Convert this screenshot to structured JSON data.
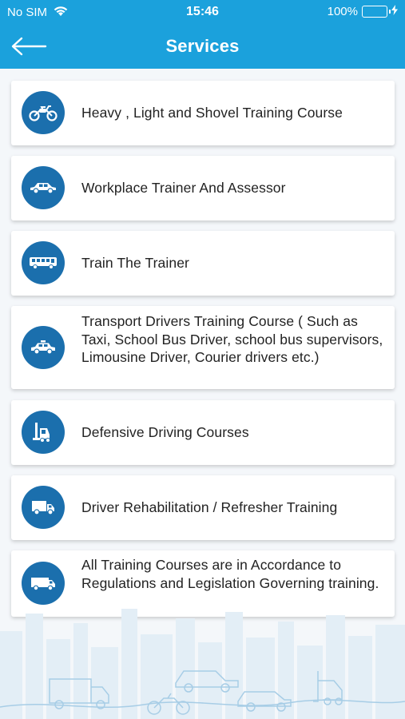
{
  "status": {
    "carrier": "No SIM",
    "time": "15:46",
    "battery": "100%",
    "battery_color": "#6ee04a"
  },
  "nav": {
    "title": "Services",
    "back_icon": "arrow-left-icon",
    "bar_color": "#1ba1dc"
  },
  "services": [
    {
      "label": "Heavy , Light and Shovel Training Course",
      "icon": "motorcycle-icon"
    },
    {
      "label": "Workplace Trainer And Assessor",
      "icon": "car-icon"
    },
    {
      "label": "Train The Trainer",
      "icon": "bus-icon"
    },
    {
      "label": "Transport Drivers Training Course ( Such as Taxi, School Bus Driver, school bus supervisors, Limousine Driver, Courier drivers etc.)",
      "icon": "taxi-icon"
    },
    {
      "label": "Defensive Driving Courses",
      "icon": "forklift-icon"
    },
    {
      "label": "Driver Rehabilitation / Refresher Training",
      "icon": "truck-icon"
    },
    {
      "label": "All Training Courses are in Accordance to Regulations and Legislation Governing training.",
      "icon": "van-icon"
    }
  ],
  "colors": {
    "icon_circle": "#1b6fad",
    "text": "#222222"
  }
}
